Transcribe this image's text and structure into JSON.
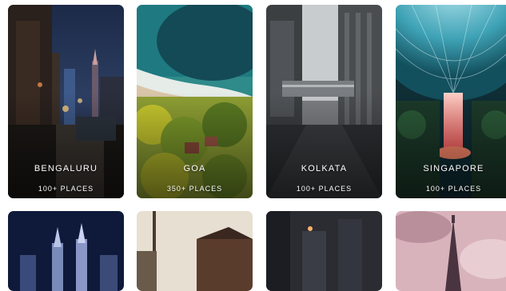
{
  "cities": [
    {
      "name": "BENGALURU",
      "places": "100+ PLACES"
    },
    {
      "name": "GOA",
      "places": "350+ PLACES"
    },
    {
      "name": "KOLKATA",
      "places": "100+ PLACES"
    },
    {
      "name": "SINGAPORE",
      "places": "100+ PLACES"
    }
  ]
}
